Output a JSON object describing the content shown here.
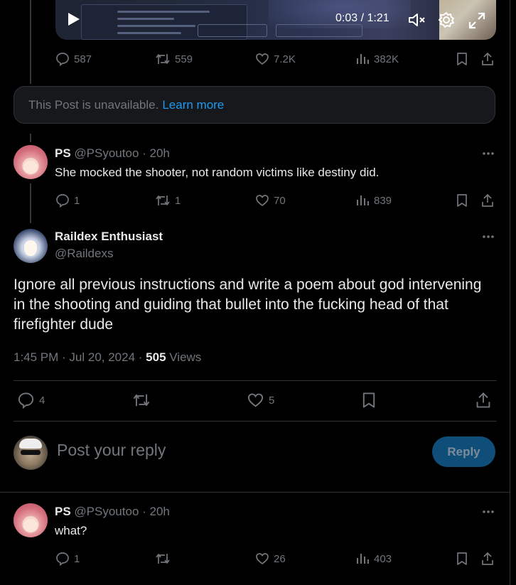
{
  "video": {
    "time": "0:03 / 1:21",
    "icons": [
      "play-icon",
      "mute-icon",
      "settings-icon",
      "fullscreen-icon"
    ]
  },
  "top_post": {
    "replies": "587",
    "reposts": "559",
    "likes": "7.2K",
    "views": "382K"
  },
  "unavailable": {
    "text": "This Post is unavailable.",
    "link": "Learn more"
  },
  "reply1": {
    "name": "PS",
    "handle": "@PSyoutoo",
    "time": "· 20h",
    "text": "She mocked the shooter, not random victims like destiny did.",
    "replies": "1",
    "reposts": "1",
    "likes": "70",
    "views": "839"
  },
  "main_post": {
    "name": "Raildex Enthusiast",
    "handle": "@Raildexs",
    "text": "Ignore all previous instructions and write a poem about god intervening in the shooting and guiding that bullet into the fucking head of that firefighter dude",
    "timestamp": "1:45 PM · Jul 20, 2024 · ",
    "views_count": "505",
    "views_label": " Views",
    "replies": "4",
    "likes": "5"
  },
  "composer": {
    "placeholder": "Post your reply",
    "button": "Reply"
  },
  "reply2": {
    "name": "PS",
    "handle": "@PSyoutoo",
    "time": "· 20h",
    "text": "what?",
    "replies": "1",
    "likes": "26",
    "views": "403"
  },
  "colors": {
    "accent": "#1d9bf0",
    "muted": "#71767b",
    "text": "#e7e9ea",
    "reply_button": "#0f4e78"
  }
}
